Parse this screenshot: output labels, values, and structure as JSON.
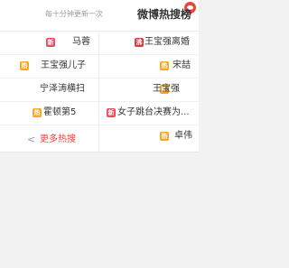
{
  "header": {
    "title": "微博热搜榜",
    "subtitle": "每十分钟更新一次"
  },
  "items": [
    {
      "text": "王宝强离婚",
      "badge": "沸",
      "badge_type": "boil"
    },
    {
      "text": "马蓉",
      "badge": "新",
      "badge_type": "new"
    },
    {
      "text": "宋喆",
      "badge": "热",
      "badge_type": "hot"
    },
    {
      "text": "王宝强儿子",
      "badge": "热",
      "badge_type": "hot"
    },
    {
      "text": "王宝强",
      "badge": "热",
      "badge_type": "hot"
    },
    {
      "text": "宁泽涛横扫",
      "badge": "",
      "badge_type": ""
    },
    {
      "text": "女子跳台决赛为...",
      "badge": "新",
      "badge_type": "new"
    },
    {
      "text": "霍顿第5",
      "badge": "热",
      "badge_type": "hot"
    },
    {
      "text": "卓伟",
      "badge": "热",
      "badge_type": "hot"
    }
  ],
  "more": {
    "label": "更多热搜",
    "arrow": "<"
  },
  "colors": {
    "accent": "#e9473d",
    "hot_badge": "#f6a623",
    "new_badge": "#e94c5f"
  }
}
